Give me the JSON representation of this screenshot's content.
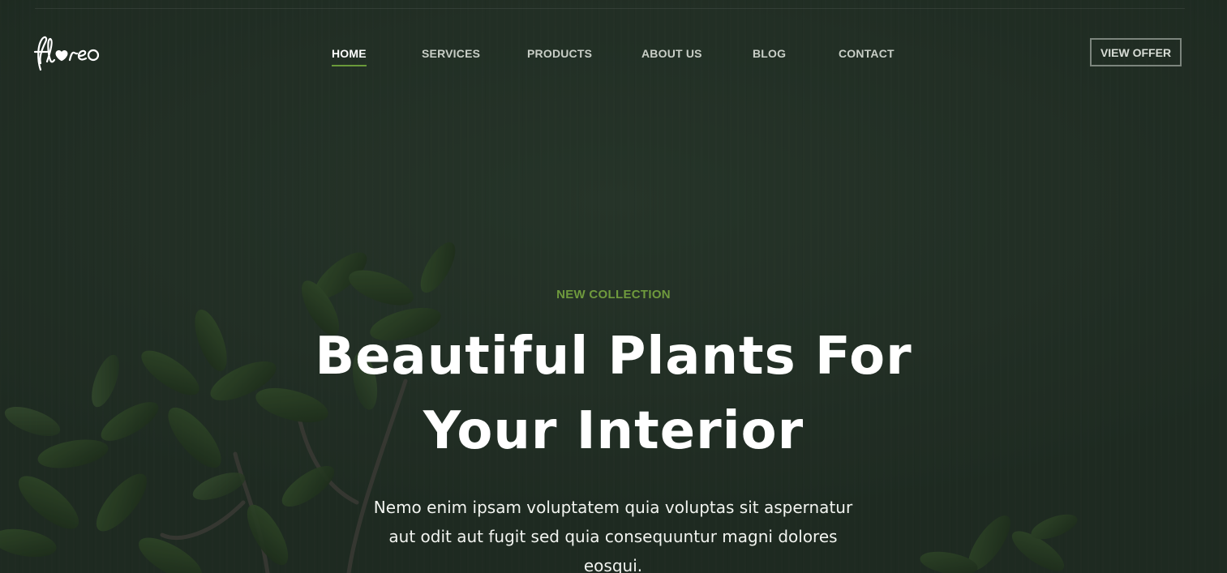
{
  "brand": {
    "logo_text": "floreo"
  },
  "nav": {
    "items": [
      {
        "label": "HOME",
        "active": true
      },
      {
        "label": "SERVICES",
        "active": false
      },
      {
        "label": "PRODUCTS",
        "active": false
      },
      {
        "label": "ABOUT US",
        "active": false
      },
      {
        "label": "BLOG",
        "active": false
      },
      {
        "label": "CONTACT",
        "active": false
      }
    ],
    "cta_label": "VIEW OFFER"
  },
  "hero": {
    "kicker": "NEW COLLECTION",
    "headline_line1": "Beautiful Plants For",
    "headline_line2": "Your Interior",
    "lead": "Nemo enim ipsam voluptatem quia voluptas sit aspernatur aut odit aut fugit sed quia consequuntur magni dolores eosqui."
  },
  "colors": {
    "background": "#243227",
    "accent_green": "#6f9a3d",
    "active_underline": "#6a9a3a",
    "text_white": "#ffffff"
  },
  "icons": [
    "heart-icon"
  ]
}
